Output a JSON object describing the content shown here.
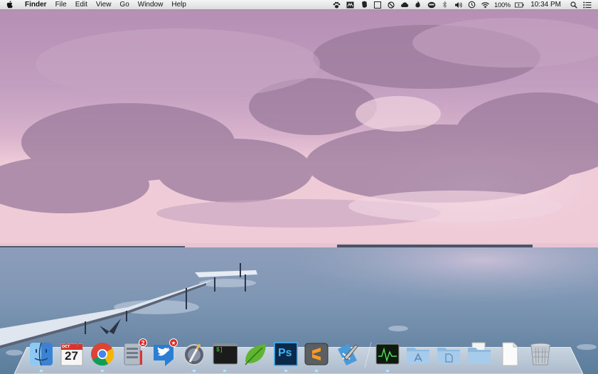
{
  "menubar": {
    "app_name": "Finder",
    "menus": [
      "File",
      "Edit",
      "View",
      "Go",
      "Window",
      "Help"
    ],
    "battery_percent": "100%",
    "clock": "10:34 PM",
    "status_icons": [
      "paw-icon",
      "bitcasa-icon",
      "evernote-icon",
      "square-icon",
      "no-sign-icon",
      "cloud-icon",
      "flame-icon",
      "helmet-icon",
      "bluetooth-icon",
      "volume-icon",
      "time-machine-icon",
      "wifi-icon",
      "battery-icon",
      "spotlight-icon",
      "notification-center-icon"
    ]
  },
  "dock": {
    "apps": [
      {
        "name": "Finder",
        "icon": "finder-icon",
        "running": true
      },
      {
        "name": "Calendar",
        "icon": "calendar-icon",
        "month": "OCT",
        "day": "27",
        "running": false
      },
      {
        "name": "Chrome",
        "icon": "chrome-icon",
        "running": true
      },
      {
        "name": "Mail",
        "icon": "mail-icon",
        "badge": "2",
        "running": false
      },
      {
        "name": "Twitter",
        "icon": "twitter-icon",
        "badge": "★",
        "running": false
      },
      {
        "name": "Preview",
        "icon": "preview-icon",
        "running": true
      },
      {
        "name": "Terminal",
        "icon": "terminal-icon",
        "text": "$]",
        "running": true
      },
      {
        "name": "Evernote",
        "icon": "leaf-icon",
        "running": false
      },
      {
        "name": "Photoshop",
        "icon": "photoshop-icon",
        "text": "Ps",
        "running": true
      },
      {
        "name": "Sublime Text",
        "icon": "sublime-icon",
        "running": true
      },
      {
        "name": "Xcode",
        "icon": "xcode-icon",
        "running": false
      },
      {
        "name": "Activity Monitor",
        "icon": "activity-monitor-icon",
        "running": true
      }
    ],
    "folders": [
      {
        "name": "Applications",
        "icon": "applications-folder-icon"
      },
      {
        "name": "Documents",
        "icon": "documents-folder-icon"
      },
      {
        "name": "Downloads",
        "icon": "downloads-folder-icon"
      },
      {
        "name": "File",
        "icon": "document-icon"
      },
      {
        "name": "Trash",
        "icon": "trash-icon"
      }
    ]
  },
  "colors": {
    "sky_top": "#b790b6",
    "horizon": "#f1c9d7",
    "water": "#8ea3bd"
  }
}
